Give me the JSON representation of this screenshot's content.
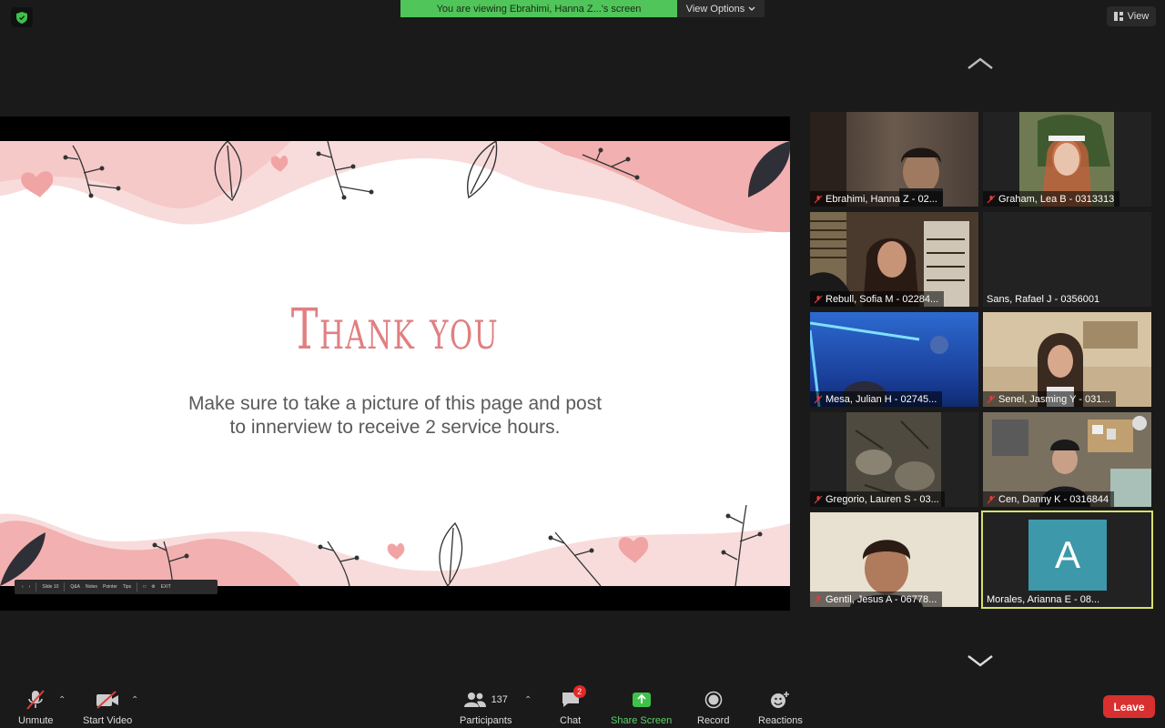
{
  "banner": {
    "viewing": "You are viewing Ebrahimi, Hanna Z...'s screen",
    "options": "View Options"
  },
  "view_button": "View",
  "slide": {
    "title": "Thank you",
    "body_line1": "Make sure to take a picture of this page and post",
    "body_line2": "to innerview to receive 2 service hours.",
    "toolbar": {
      "slide": "Slide 10",
      "qa": "Q&A",
      "notes": "Notes",
      "pointer": "Pointer",
      "tips": "Tips",
      "exit": "EXIT"
    }
  },
  "participants_tiles": [
    {
      "name": "Ebrahimi, Hanna Z - 02...",
      "muted": true,
      "video_color": "#5b4a40"
    },
    {
      "name": "Graham, Lea B - 0313313",
      "muted": true,
      "video_color": "#7a6a5a"
    },
    {
      "name": "Rebull, Sofia M - 02284...",
      "muted": true,
      "video_color": "#4a3a30"
    },
    {
      "name": "Sans, Rafael J - 0356001",
      "muted": false,
      "video_color": "#222222"
    },
    {
      "name": "Mesa, Julian H - 02745...",
      "muted": true,
      "video_color": "#1f4aa8"
    },
    {
      "name": "Senel, Jasming Y - 031...",
      "muted": true,
      "video_color": "#cbb79a"
    },
    {
      "name": "Gregorio, Lauren S - 03...",
      "muted": true,
      "video_color": "#5a5448"
    },
    {
      "name": "Cen, Danny K - 0316844",
      "muted": true,
      "video_color": "#6e6a5e"
    },
    {
      "name": "Gentil, Jesus A - 06778...",
      "muted": true,
      "video_color": "#8a6a55"
    },
    {
      "name": "Morales, Arianna E - 08...",
      "muted": false,
      "avatar": "A"
    }
  ],
  "toolbar": {
    "unmute": "Unmute",
    "start_video": "Start Video",
    "participants": "Participants",
    "participants_count": "137",
    "chat": "Chat",
    "chat_badge": "2",
    "share_screen": "Share Screen",
    "record": "Record",
    "reactions": "Reactions",
    "leave": "Leave"
  },
  "colors": {
    "accent_green": "#4fc55a",
    "leave_red": "#d8302f",
    "slide_pink": "#e07f82",
    "active_speaker": "#d7e06a"
  }
}
